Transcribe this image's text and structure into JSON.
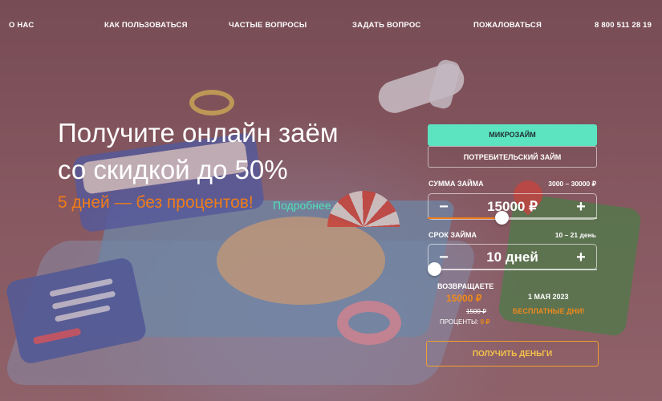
{
  "nav": {
    "items": [
      {
        "label": "О НАС"
      },
      {
        "label": "КАК ПОЛЬЗОВАТЬСЯ"
      },
      {
        "label": "ЧАСТЫЕ ВОПРОСЫ"
      },
      {
        "label": "ЗАДАТЬ ВОПРОС"
      },
      {
        "label": "ПОЖАЛОВАТЬСЯ"
      }
    ],
    "phone": "8 800 511 28 19"
  },
  "hero": {
    "title_line1": "Получите онлайн заём",
    "title_line2": "со скидкой до 50%",
    "subtitle": "5 дней — без процентов!",
    "more_link": "Подробнее..."
  },
  "calculator": {
    "tabs": {
      "active": "МИКРОЗАЙМ",
      "inactive": "ПОТРЕБИТЕЛЬСКИЙ ЗАЙМ"
    },
    "amount": {
      "label": "СУММА ЗАЙМА",
      "range": "3000 – 30000 ₽",
      "value": "15000 ₽",
      "minus": "−",
      "plus": "+",
      "slider_fraction": 0.44
    },
    "term": {
      "label": "СРОК ЗАЙМА",
      "range": "10 – 21 день",
      "value": "10 дней",
      "minus": "−",
      "plus": "+",
      "slider_fraction": 0.0
    },
    "summary": {
      "return_label": "ВОЗВРАЩАЕТЕ",
      "return_amount": "15000 ₽",
      "old_amount": "1500 ₽",
      "interest_label": "ПРОЦЕНТЫ:",
      "interest_value": "0 ₽",
      "date": "1 МАЯ 2023",
      "free_days": "БЕСПЛАТНЫЕ ДНИ!"
    },
    "cta": "ПОЛУЧИТЬ ДЕНЬГИ"
  },
  "colors": {
    "accent_mint": "#5ce4c0",
    "accent_orange": "#ee7c1a",
    "cta_border": "#f0a030"
  }
}
